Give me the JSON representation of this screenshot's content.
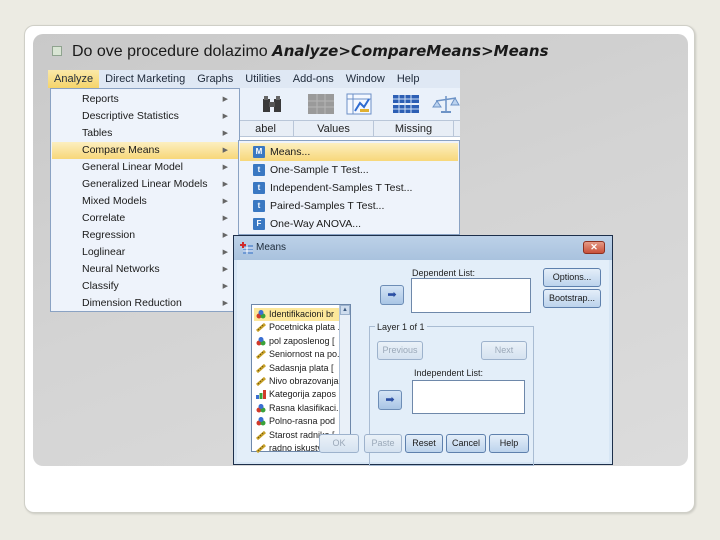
{
  "slide": {
    "bullet_text": "Do ove procedure dolazimo ",
    "bullet_emphasis": "Analyze>CompareMeans>Means"
  },
  "menubar": {
    "items": [
      "Analyze",
      "Direct Marketing",
      "Graphs",
      "Utilities",
      "Add-ons",
      "Window",
      "Help"
    ],
    "active": "Analyze"
  },
  "toolbar": {
    "icons": [
      "dropdown-icon",
      "binoculars-icon",
      "grid-icon",
      "chart-edit-icon",
      "table-icon",
      "scales-icon"
    ]
  },
  "grid_headers": [
    "abel",
    "Values",
    "Missing"
  ],
  "analyze_menu": {
    "items": [
      {
        "label": "Reports",
        "submenu": true
      },
      {
        "label": "Descriptive Statistics",
        "submenu": true
      },
      {
        "label": "Tables",
        "submenu": true
      },
      {
        "label": "Compare Means",
        "submenu": true,
        "highlighted": true
      },
      {
        "label": "General Linear Model",
        "submenu": true
      },
      {
        "label": "Generalized Linear Models",
        "submenu": true
      },
      {
        "label": "Mixed Models",
        "submenu": true
      },
      {
        "label": "Correlate",
        "submenu": true
      },
      {
        "label": "Regression",
        "submenu": true
      },
      {
        "label": "Loglinear",
        "submenu": true
      },
      {
        "label": "Neural Networks",
        "submenu": true
      },
      {
        "label": "Classify",
        "submenu": true
      },
      {
        "label": "Dimension Reduction",
        "submenu": true
      }
    ]
  },
  "compare_means_submenu": {
    "items": [
      {
        "label": "Means...",
        "icon": "M",
        "highlighted": true
      },
      {
        "label": "One-Sample T Test...",
        "icon": "t"
      },
      {
        "label": "Independent-Samples T Test...",
        "icon": "t"
      },
      {
        "label": "Paired-Samples T Test...",
        "icon": "t"
      },
      {
        "label": "One-Way ANOVA...",
        "icon": "F"
      }
    ]
  },
  "dialog": {
    "title": "Means",
    "close_label": "✕",
    "variables": [
      {
        "label": "Identifikacioni br",
        "type": "nominal",
        "selected": true
      },
      {
        "label": "Pocetnicka plata ...",
        "type": "scale"
      },
      {
        "label": "pol zaposlenog [",
        "type": "nominal"
      },
      {
        "label": "Seniornost na po...",
        "type": "scale"
      },
      {
        "label": "Sadasnja plata [",
        "type": "scale"
      },
      {
        "label": "Nivo obrazovanja...",
        "type": "scale"
      },
      {
        "label": "Kategorija zapos",
        "type": "ordinal"
      },
      {
        "label": "Rasna klasifikaci...",
        "type": "nominal"
      },
      {
        "label": "Polno-rasna pod",
        "type": "nominal"
      },
      {
        "label": "Starost radnika [..",
        "type": "scale"
      },
      {
        "label": "radno iskustvo [r",
        "type": "scale"
      }
    ],
    "dependent_label": "Dependent List:",
    "layer_label": "Layer 1 of 1",
    "previous_label": "Previous",
    "next_label": "Next",
    "independent_label": "Independent List:",
    "options_label": "Options...",
    "bootstrap_label": "Bootstrap...",
    "buttons": {
      "ok": "OK",
      "paste": "Paste",
      "reset": "Reset",
      "cancel": "Cancel",
      "help": "Help"
    },
    "move_arrow": "➡"
  }
}
